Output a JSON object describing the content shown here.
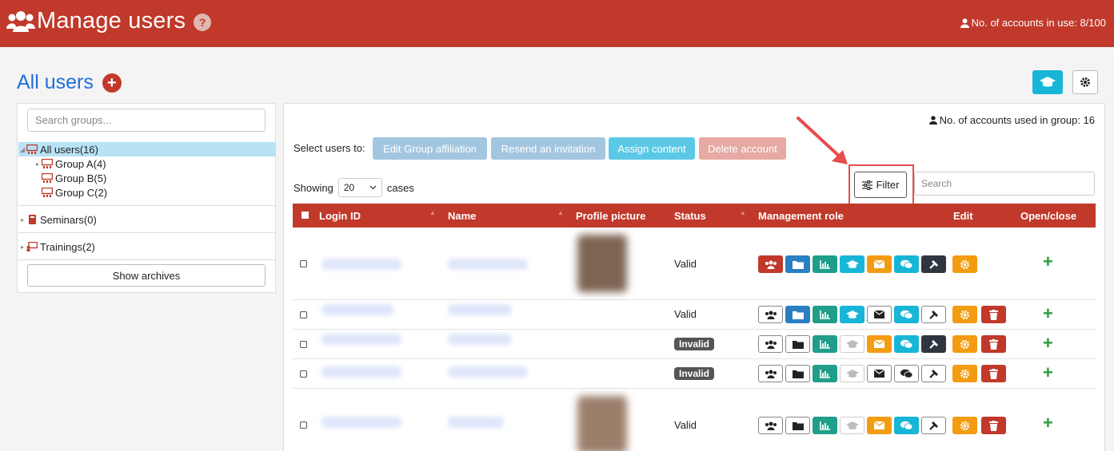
{
  "header": {
    "title": "Manage users",
    "help_symbol": "?",
    "accounts_in_use": "No. of accounts in use: 8/100"
  },
  "page": {
    "title": "All users",
    "add_symbol": "+"
  },
  "groups_panel": {
    "search_placeholder": "Search groups...",
    "tree": [
      {
        "label": "All users(16)",
        "selected": true
      },
      {
        "label": "Group A(4)"
      },
      {
        "label": "Group B(5)"
      },
      {
        "label": "Group C(2)"
      }
    ],
    "seminars": "Seminars(0)",
    "trainings": "Trainings(2)",
    "show_archives": "Show archives"
  },
  "users_panel": {
    "used_in_group": "No. of accounts used in group: 16",
    "select_label": "Select users to:",
    "actions": [
      {
        "label": "Edit Group affiliation",
        "color": "#a3c6e0"
      },
      {
        "label": "Resend an invitation",
        "color": "#a3c6e0"
      },
      {
        "label": "Assign content",
        "color": "#5bc9e6"
      },
      {
        "label": "Delete account",
        "color": "#e6a9a3"
      }
    ],
    "showing_prefix": "Showing",
    "page_size": "20",
    "showing_suffix": "cases",
    "filter_label": "Filter",
    "search_placeholder": "Search",
    "columns": [
      "Login ID",
      "Name",
      "Profile picture",
      "Status",
      "Management role",
      "Edit",
      "Open/close"
    ],
    "rows": [
      {
        "status": "Valid",
        "status_type": "text",
        "open": "+"
      },
      {
        "status": "Valid",
        "status_type": "text",
        "open": "+"
      },
      {
        "status": "Invalid",
        "status_type": "badge",
        "open": "+"
      },
      {
        "status": "Invalid",
        "status_type": "badge",
        "open": "+"
      },
      {
        "status": "Valid",
        "status_type": "text",
        "open": "+"
      }
    ]
  },
  "colors": {
    "brand_red": "#c0392b",
    "link_blue": "#1e6fd9",
    "teal": "#17b6d8",
    "green": "#1f9e89",
    "orange": "#f39c12",
    "dark": "#2f3640"
  }
}
